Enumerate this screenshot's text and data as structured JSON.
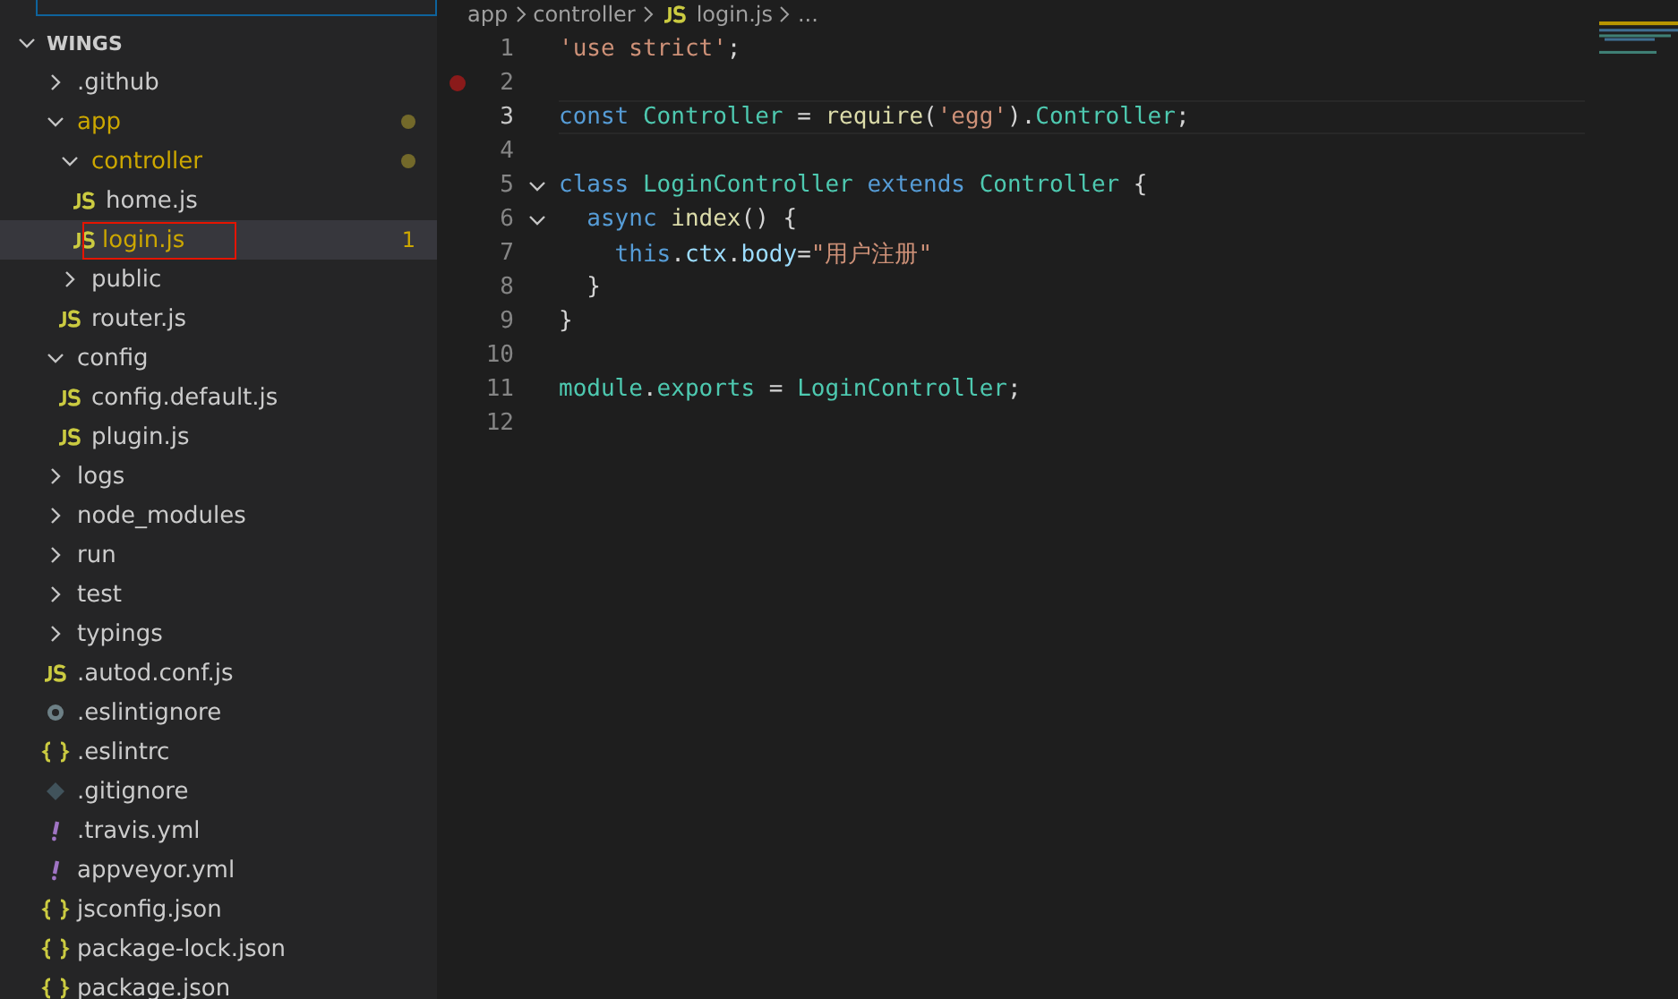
{
  "breadcrumb": [
    "app",
    "controller",
    "login.js",
    "..."
  ],
  "explorer": {
    "root": {
      "label": "WINGS",
      "expanded": true
    },
    "items": [
      {
        "label": ".github",
        "kind": "folder",
        "expanded": false,
        "selected": false,
        "warning": false
      },
      {
        "label": "app",
        "kind": "folder",
        "expanded": true,
        "selected": false,
        "warning": true,
        "children": [
          {
            "label": "controller",
            "kind": "folder",
            "expanded": true,
            "selected": false,
            "warning": true,
            "children": [
              {
                "label": "home.js",
                "kind": "js",
                "selected": false,
                "warning": false
              },
              {
                "label": "login.js",
                "kind": "js",
                "selected": true,
                "warning": true,
                "badge": "1"
              }
            ]
          },
          {
            "label": "public",
            "kind": "folder",
            "expanded": false,
            "selected": false,
            "warning": false
          },
          {
            "label": "router.js",
            "kind": "js",
            "selected": false,
            "warning": false
          }
        ]
      },
      {
        "label": "config",
        "kind": "folder",
        "expanded": true,
        "selected": false,
        "warning": false,
        "children": [
          {
            "label": "config.default.js",
            "kind": "js",
            "selected": false,
            "warning": false
          },
          {
            "label": "plugin.js",
            "kind": "js",
            "selected": false,
            "warning": false
          }
        ]
      },
      {
        "label": "logs",
        "kind": "folder",
        "expanded": false,
        "selected": false,
        "warning": false
      },
      {
        "label": "node_modules",
        "kind": "folder",
        "expanded": false,
        "selected": false,
        "warning": false
      },
      {
        "label": "run",
        "kind": "folder",
        "expanded": false,
        "selected": false,
        "warning": false
      },
      {
        "label": "test",
        "kind": "folder",
        "expanded": false,
        "selected": false,
        "warning": false
      },
      {
        "label": "typings",
        "kind": "folder",
        "expanded": false,
        "selected": false,
        "warning": false
      },
      {
        "label": ".autod.conf.js",
        "kind": "js",
        "selected": false,
        "warning": false
      },
      {
        "label": ".eslintignore",
        "kind": "config",
        "selected": false,
        "warning": false
      },
      {
        "label": ".eslintrc",
        "kind": "json",
        "selected": false,
        "warning": false
      },
      {
        "label": ".gitignore",
        "kind": "git",
        "selected": false,
        "warning": false
      },
      {
        "label": ".travis.yml",
        "kind": "yaml",
        "selected": false,
        "warning": false
      },
      {
        "label": "appveyor.yml",
        "kind": "yaml",
        "selected": false,
        "warning": false
      },
      {
        "label": "jsconfig.json",
        "kind": "json",
        "selected": false,
        "warning": false
      },
      {
        "label": "package-lock.json",
        "kind": "json",
        "selected": false,
        "warning": false
      },
      {
        "label": "package.json",
        "kind": "json",
        "selected": false,
        "warning": false
      }
    ]
  },
  "editor": {
    "lines": [
      {
        "number": "1",
        "current": false,
        "breakpoint": false,
        "foldable": false,
        "tokens": [
          {
            "t": "'use strict'",
            "kind": "str"
          },
          {
            "t": ";",
            "kind": "punc"
          }
        ]
      },
      {
        "number": "2",
        "current": false,
        "breakpoint": true,
        "foldable": false
      },
      {
        "number": "3",
        "current": true,
        "breakpoint": false,
        "foldable": false,
        "tokens": [
          {
            "t": "const ",
            "kind": "kw"
          },
          {
            "t": "Controller",
            "kind": "cls"
          },
          {
            "t": " = ",
            "kind": "punc"
          },
          {
            "t": "require",
            "kind": "fn"
          },
          {
            "t": "(",
            "kind": "punc"
          },
          {
            "t": "'egg'",
            "kind": "str"
          },
          {
            "t": ").",
            "kind": "punc"
          },
          {
            "t": "Controller",
            "kind": "cls"
          },
          {
            "t": ";",
            "kind": "punc"
          }
        ]
      },
      {
        "number": "4",
        "current": false,
        "breakpoint": false,
        "foldable": false
      },
      {
        "number": "5",
        "current": false,
        "breakpoint": false,
        "foldable": true,
        "tokens": [
          {
            "t": "class ",
            "kind": "kw"
          },
          {
            "t": "LoginController ",
            "kind": "cls"
          },
          {
            "t": "extends ",
            "kind": "kw"
          },
          {
            "t": "Controller",
            "kind": "cls"
          },
          {
            "t": " {",
            "kind": "punc"
          }
        ]
      },
      {
        "number": "6",
        "current": false,
        "breakpoint": false,
        "foldable": true,
        "tokens": [
          {
            "t": "  async ",
            "kind": "kw"
          },
          {
            "t": "index",
            "kind": "fn"
          },
          {
            "t": "() {",
            "kind": "punc"
          }
        ]
      },
      {
        "number": "7",
        "current": false,
        "breakpoint": false,
        "foldable": false,
        "tokens": [
          {
            "t": "    this",
            "kind": "kw"
          },
          {
            "t": ".",
            "kind": "punc"
          },
          {
            "t": "ctx",
            "kind": "prop"
          },
          {
            "t": ".",
            "kind": "punc"
          },
          {
            "t": "body",
            "kind": "prop"
          },
          {
            "t": "=",
            "kind": "punc"
          },
          {
            "t": "\"用户注册\"",
            "kind": "str"
          }
        ]
      },
      {
        "number": "8",
        "current": false,
        "breakpoint": false,
        "foldable": false,
        "tokens": [
          {
            "t": "  }",
            "kind": "punc"
          }
        ]
      },
      {
        "number": "9",
        "current": false,
        "breakpoint": false,
        "foldable": false,
        "tokens": [
          {
            "t": "}",
            "kind": "punc"
          }
        ]
      },
      {
        "number": "10",
        "current": false,
        "breakpoint": false,
        "foldable": false
      },
      {
        "number": "11",
        "current": false,
        "breakpoint": false,
        "foldable": false,
        "tokens": [
          {
            "t": "module",
            "kind": "cls"
          },
          {
            "t": ".",
            "kind": "punc"
          },
          {
            "t": "exports",
            "kind": "cls"
          },
          {
            "t": " = ",
            "kind": "punc"
          },
          {
            "t": "LoginController",
            "kind": "cls"
          },
          {
            "t": ";",
            "kind": "punc"
          }
        ]
      },
      {
        "number": "12",
        "current": false,
        "breakpoint": false,
        "foldable": false
      }
    ]
  }
}
